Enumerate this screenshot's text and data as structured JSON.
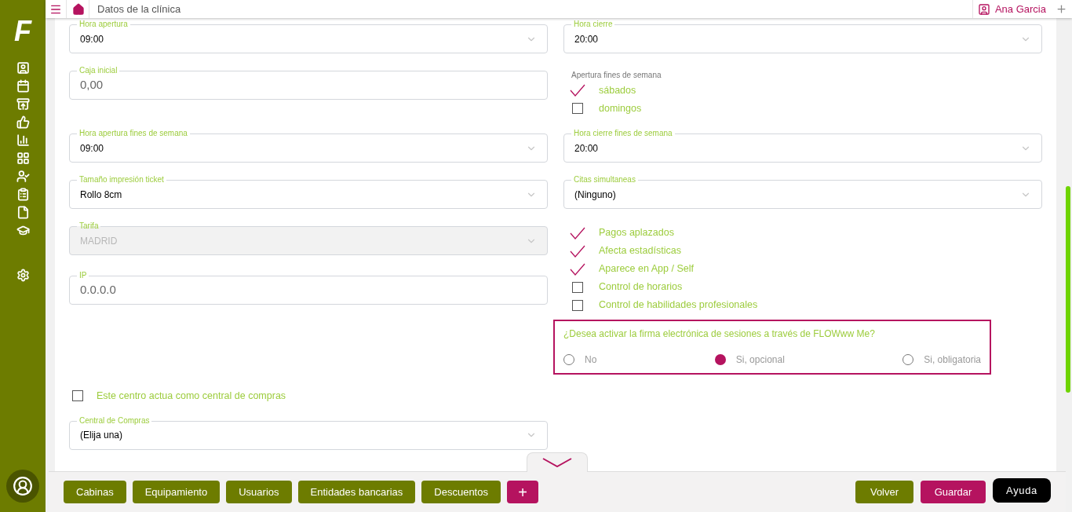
{
  "logo": "F",
  "header": {
    "title": "Datos de la clínica",
    "user": "Ana Garcia"
  },
  "top_fields": [
    {
      "kind": "select",
      "label": "Hora apertura",
      "value": "09:00"
    },
    {
      "kind": "select",
      "label": "Hora cierre",
      "value": "20:00"
    },
    {
      "kind": "input",
      "label": "Caja inicial",
      "value": "0,00"
    },
    {
      "kind": "checkgroup",
      "label": "Apertura fines de semana",
      "options": [
        {
          "label": "sábados",
          "checked": true
        },
        {
          "label": "domingos",
          "checked": false
        }
      ]
    },
    {
      "kind": "select",
      "label": "Hora apertura fines de semana",
      "value": "09:00"
    },
    {
      "kind": "select",
      "label": "Hora cierre fines de semana",
      "value": "20:00"
    },
    {
      "kind": "select",
      "label": "Tamaño impresión ticket",
      "value": "Rollo 8cm"
    },
    {
      "kind": "select",
      "label": "Citas simultaneas",
      "value": "(Ninguno)"
    }
  ],
  "left_fields": [
    {
      "kind": "select",
      "label": "Tarifa",
      "value": "MADRID",
      "disabled": true
    },
    {
      "kind": "input",
      "label": "IP",
      "value": "0.0.0.0",
      "disabled": false
    }
  ],
  "options": [
    {
      "label": "Pagos aplazados",
      "checked": true
    },
    {
      "label": "Afecta estadísticas",
      "checked": true
    },
    {
      "label": "Aparece en App / Self",
      "checked": true
    },
    {
      "label": "Control de horarios",
      "checked": false
    },
    {
      "label": "Control de habilidades profesionales",
      "checked": false
    }
  ],
  "signature": {
    "question": "¿Desea activar la firma electrónica de sesiones a través de FLOWww Me?",
    "options": [
      {
        "label": "No",
        "selected": false
      },
      {
        "label": "Si, opcional",
        "selected": true
      },
      {
        "label": "Si, obligatoria",
        "selected": false
      }
    ]
  },
  "purchasing": {
    "checkbox": {
      "label": "Este centro actua como central de compras",
      "checked": false
    },
    "field": {
      "kind": "select",
      "label": "Central de Compras",
      "value": "(Elija una)"
    }
  },
  "footer": {
    "tabs": [
      "Cabinas",
      "Equipamiento",
      "Usuarios",
      "Entidades bancarias",
      "Descuentos"
    ],
    "add": "+",
    "actions": [
      {
        "kind": "back",
        "label": "Volver"
      },
      {
        "kind": "save",
        "label": "Guardar"
      },
      {
        "kind": "help",
        "label": "Ayuda"
      }
    ]
  }
}
